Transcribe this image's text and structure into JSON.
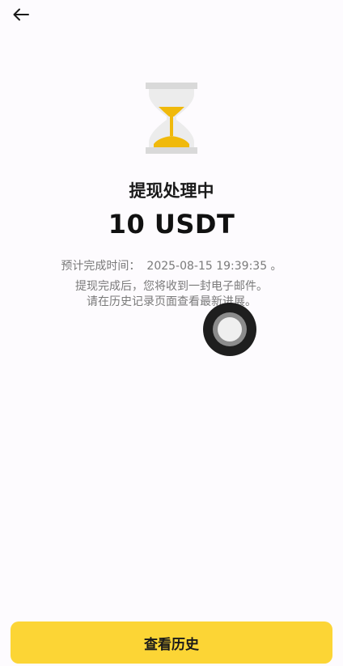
{
  "header": {
    "back_icon": "arrow-left-icon"
  },
  "status": {
    "icon": "hourglass-icon",
    "title": "提现处理中",
    "amount": "10 USDT",
    "eta_label": "预计完成时间：",
    "eta_value": "2025-08-15 19:39:35 。",
    "note_line1": "提现完成后，您将收到一封电子邮件。",
    "note_line2": "请在历史记录页面查看最新进展。"
  },
  "footer": {
    "history_button_label": "查看历史"
  },
  "colors": {
    "accent": "#fcd535",
    "hourglass_frame": "#d9d9d9",
    "hourglass_sand": "#f0b90b",
    "text_secondary": "#7a7a7a"
  }
}
